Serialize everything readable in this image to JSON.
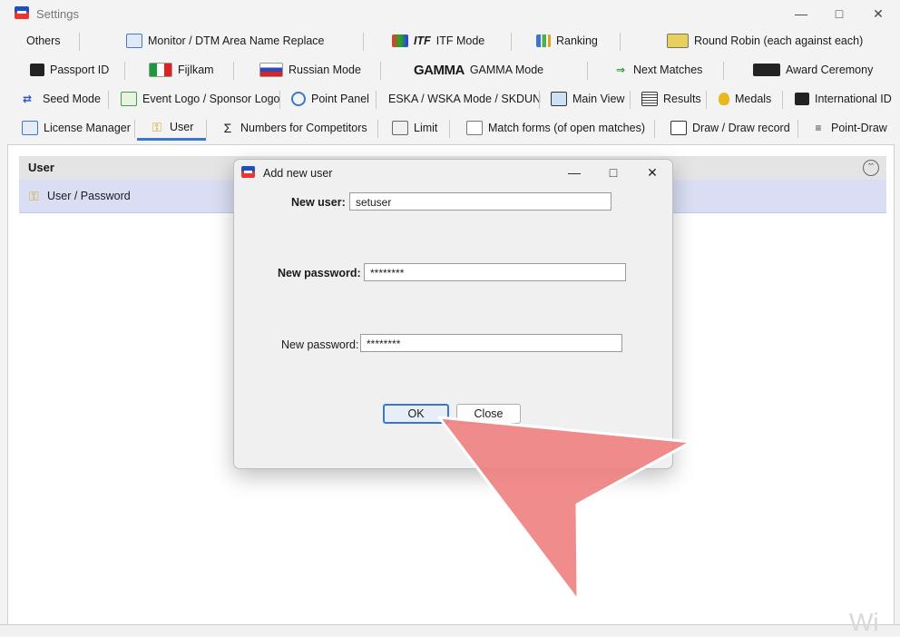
{
  "window": {
    "title": "Settings"
  },
  "tabs": {
    "row1": [
      "Others",
      "Monitor / DTM Area Name Replace",
      "ITF Mode",
      "Ranking",
      "Round Robin (each against each)"
    ],
    "row2": [
      "Passport ID",
      "Fijlkam",
      "Russian Mode",
      "GAMMA Mode",
      "Next Matches",
      "Award Ceremony"
    ],
    "row3": [
      "Seed Mode",
      "Event Logo / Sponsor Logo",
      "Point Panel",
      "ESKA / WSKA Mode / SKDUN",
      "Main View",
      "Results",
      "Medals",
      "International ID"
    ],
    "row4": [
      "License Manager",
      "User",
      "Numbers for Competitors",
      "Limit",
      "Match forms (of open matches)",
      "Draw / Draw record",
      "Point-Draw"
    ],
    "active": "User",
    "logo_texts": {
      "itf": "ITF",
      "gamma": "GAMMA"
    }
  },
  "user_panel": {
    "header": "User",
    "row_label": "User / Password"
  },
  "dialog": {
    "title": "Add new user",
    "new_user_label": "New user:",
    "new_user_value": "setuser",
    "new_password_label": "New password:",
    "new_password_value": "********",
    "confirm_password_label": "New password:",
    "confirm_password_value": "********",
    "ok_label": "OK",
    "close_label": "Close"
  },
  "watermark": "Wi",
  "colors": {
    "accent": "#3a77c9",
    "arrow": "#f08080",
    "row_highlight": "#d9def4"
  }
}
